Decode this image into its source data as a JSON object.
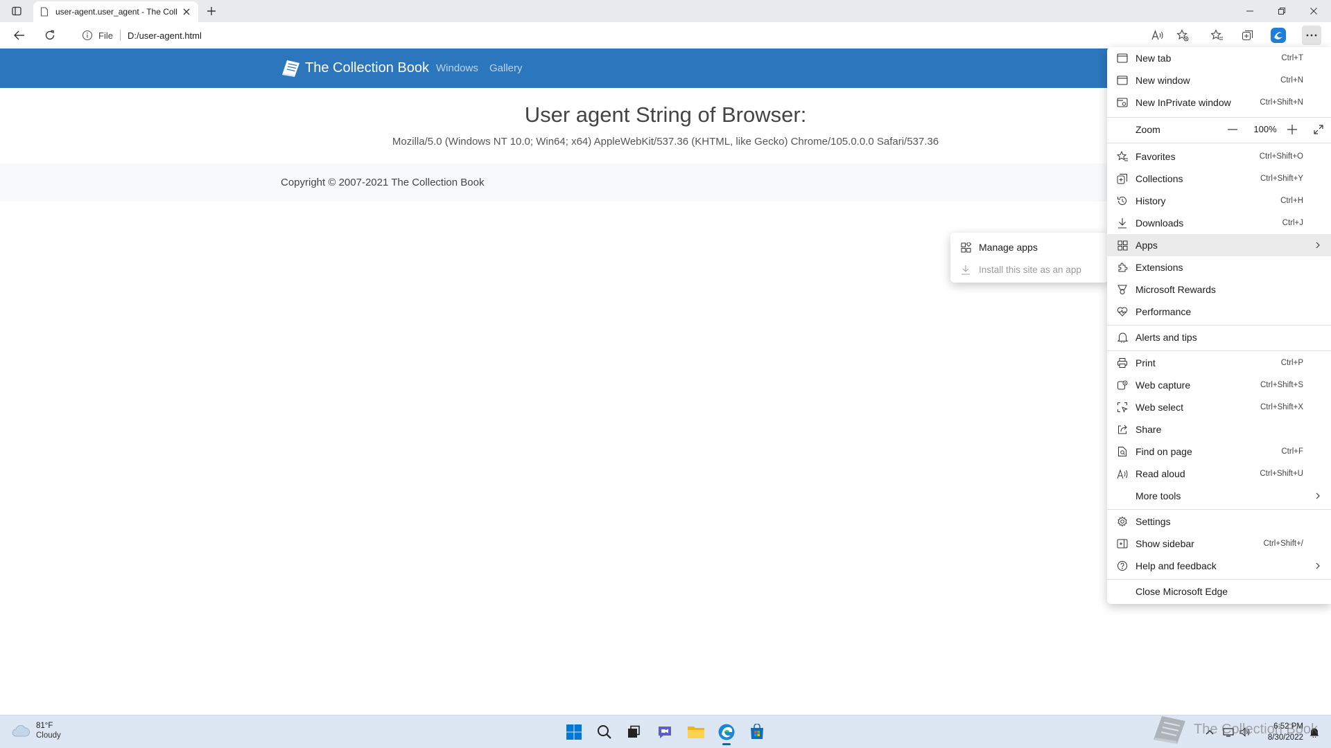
{
  "browser": {
    "tab_title": "user-agent.user_agent - The Coll",
    "address": {
      "scheme_label": "File",
      "url": "D:/user-agent.html"
    }
  },
  "page": {
    "brand": "The Collection Book",
    "nav": [
      "Windows",
      "Gallery"
    ],
    "heading": "User agent String of Browser:",
    "user_agent": "Mozilla/5.0 (Windows NT 10.0; Win64; x64) AppleWebKit/537.36 (KHTML, like Gecko) Chrome/105.0.0.0 Safari/537.36",
    "copyright": "Copyright © 2007-2021 The Collection Book"
  },
  "menu": {
    "items": [
      {
        "label": "New tab",
        "shortcut": "Ctrl+T",
        "icon": "new-tab-icon"
      },
      {
        "label": "New window",
        "shortcut": "Ctrl+N",
        "icon": "new-window-icon"
      },
      {
        "label": "New InPrivate window",
        "shortcut": "Ctrl+Shift+N",
        "icon": "inprivate-icon"
      },
      {
        "label": "Zoom",
        "value": "100%"
      },
      {
        "label": "Favorites",
        "shortcut": "Ctrl+Shift+O",
        "icon": "favorites-icon"
      },
      {
        "label": "Collections",
        "shortcut": "Ctrl+Shift+Y",
        "icon": "collections-icon"
      },
      {
        "label": "History",
        "shortcut": "Ctrl+H",
        "icon": "history-icon"
      },
      {
        "label": "Downloads",
        "shortcut": "Ctrl+J",
        "icon": "download-icon"
      },
      {
        "label": "Apps",
        "shortcut": "",
        "icon": "apps-icon"
      },
      {
        "label": "Extensions",
        "shortcut": "",
        "icon": "extensions-icon"
      },
      {
        "label": "Microsoft Rewards",
        "shortcut": "",
        "icon": "rewards-icon"
      },
      {
        "label": "Performance",
        "shortcut": "",
        "icon": "performance-icon"
      },
      {
        "label": "Alerts and tips",
        "shortcut": "",
        "icon": "bell-icon"
      },
      {
        "label": "Print",
        "shortcut": "Ctrl+P",
        "icon": "print-icon"
      },
      {
        "label": "Web capture",
        "shortcut": "Ctrl+Shift+S",
        "icon": "web-capture-icon"
      },
      {
        "label": "Web select",
        "shortcut": "Ctrl+Shift+X",
        "icon": "web-select-icon"
      },
      {
        "label": "Share",
        "shortcut": "",
        "icon": "share-icon"
      },
      {
        "label": "Find on page",
        "shortcut": "Ctrl+F",
        "icon": "find-icon"
      },
      {
        "label": "Read aloud",
        "shortcut": "Ctrl+Shift+U",
        "icon": "read-aloud-icon"
      },
      {
        "label": "More tools",
        "shortcut": ""
      },
      {
        "label": "Settings",
        "shortcut": "",
        "icon": "gear-icon"
      },
      {
        "label": "Show sidebar",
        "shortcut": "Ctrl+Shift+/",
        "icon": "sidebar-icon"
      },
      {
        "label": "Help and feedback",
        "shortcut": "",
        "icon": "help-icon"
      },
      {
        "label": "Close Microsoft Edge",
        "shortcut": ""
      }
    ]
  },
  "apps_submenu": {
    "items": [
      {
        "label": "Manage apps",
        "disabled": false
      },
      {
        "label": "Install this site as an app",
        "disabled": true
      }
    ]
  },
  "taskbar": {
    "weather": {
      "temp": "81°F",
      "condition": "Cloudy"
    },
    "clock": {
      "time": "6:52 PM",
      "date": "8/30/2022"
    }
  },
  "watermark": "The Collection Book",
  "colors": {
    "site_header": "#2c76bd",
    "accent": "#0067c0",
    "menu_highlight": "#ebebeb"
  }
}
